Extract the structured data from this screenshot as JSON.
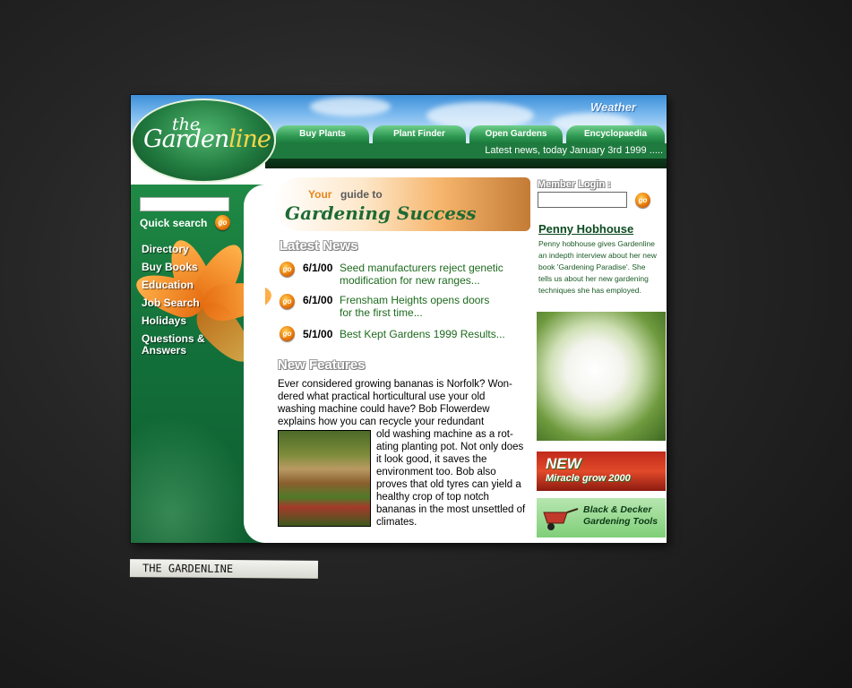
{
  "header": {
    "weather_label": "Weather",
    "logo": {
      "the": "the",
      "garden": "Garden",
      "line": "line"
    },
    "tabs": [
      {
        "label": "Buy Plants"
      },
      {
        "label": "Plant Finder"
      },
      {
        "label": "Open Gardens"
      },
      {
        "label": "Encyclopaedia"
      }
    ],
    "news_ticker": "Latest news, today January 3rd 1999 ....."
  },
  "sidebar": {
    "quick_search_label": "Quick search",
    "go_label": "go",
    "nav": [
      {
        "label": "Directory"
      },
      {
        "label": "Buy Books"
      },
      {
        "label": "Education"
      },
      {
        "label": "Job Search"
      },
      {
        "label": "Holidays"
      },
      {
        "label": "Questions & Answers"
      }
    ]
  },
  "banner": {
    "your": "Your",
    "guide": "guide to",
    "title": "Gardening Success"
  },
  "latest_news": {
    "heading": "Latest News",
    "items": [
      {
        "date": "6/1/00",
        "text": "Seed manufacturers reject genetic modification for new ranges..."
      },
      {
        "date": "6/1/00",
        "text": "Frensham Heights opens doors for the first time..."
      },
      {
        "date": "5/1/00",
        "text": "Best Kept Gardens 1999 Results..."
      }
    ]
  },
  "new_features": {
    "heading": "New Features",
    "text_top": "Ever considered growing bananas is Norfolk? Won-dered what practical horticultural use your  old washing machine could have? Bob  Flowerdew explains how you can  recycle your redundant",
    "text_side": "old washing machine as a rot-ating planting pot. Not only does it look good, it  saves the environment too.  Bob also proves that old tyres can yield a healthy crop of top notch bananas in the most unsettled of climates."
  },
  "member": {
    "label": "Member Login :",
    "go_label": "go"
  },
  "penny": {
    "title": "Penny Hobhouse",
    "text": "Penny hobhouse gives Gardenline an indepth interview about her new book 'Gardening Paradise'.   She tells us about her new gardening techniques she has employed."
  },
  "ads": {
    "ad1_new": "NEW",
    "ad1_sub": "Miracle grow 2000",
    "ad2_text": "Black & Decker Gardening Tools"
  },
  "footer_label": "THE GARDENLINE"
}
